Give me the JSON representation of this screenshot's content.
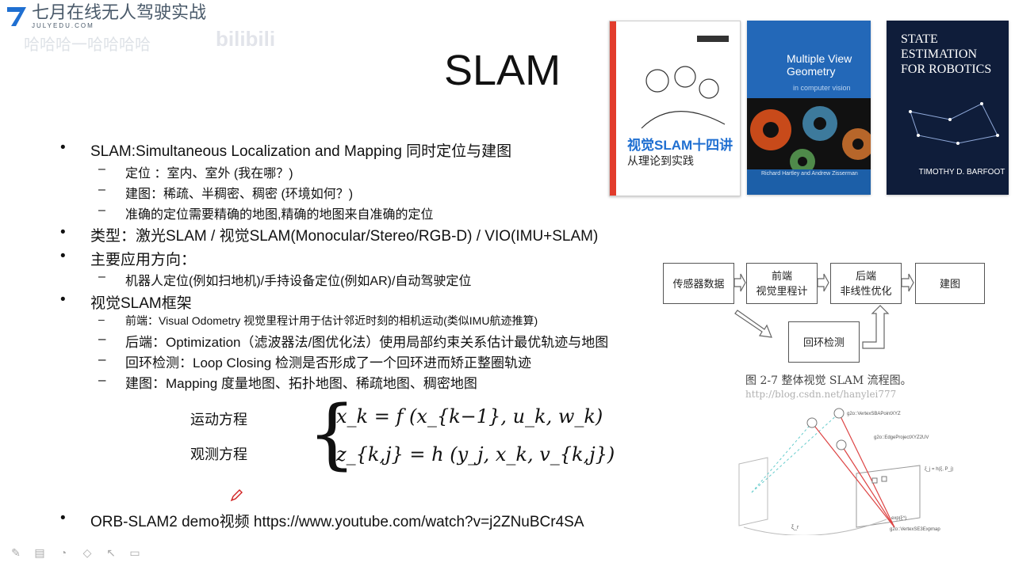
{
  "brand": {
    "name": "七月在线",
    "course": "无人驾驶实战",
    "domain": "JULYEDU.COM"
  },
  "watermark": {
    "text1": "哈哈哈一哈哈哈哈",
    "text2": "bilibili"
  },
  "slide": {
    "title": "SLAM",
    "bullets": {
      "b1": "SLAM:Simultaneous Localization and Mapping  同时定位与建图",
      "b1_subs": [
        "定位 ：室内、室外  (我在哪？)",
        "建图：稀疏、半稠密、稠密 (环境如何？)",
        "准确的定位需要精确的地图,精确的地图来自准确的定位"
      ],
      "b2": "类型：激光SLAM / 视觉SLAM(Monocular/Stereo/RGB-D) / VIO(IMU+SLAM)",
      "b3": "主要应用方向：",
      "b3_subs": [
        "机器人定位(例如扫地机)/手持设备定位(例如AR)/自动驾驶定位"
      ],
      "b4": "视觉SLAM框架",
      "b4_subs": [
        "前端：Visual Odometry  视觉里程计用于估计邻近时刻的相机运动(类似IMU航迹推算)",
        "后端：Optimization（滤波器法/图优化法）使用局部约束关系估计最优轨迹与地图",
        "回环检测：Loop Closing 检测是否形成了一个回环进而矫正整圈轨迹",
        "建图：Mapping  度量地图、拓扑地图、稀疏地图、稠密地图"
      ],
      "b5": "ORB-SLAM2 demo视频 https://www.youtube.com/watch?v=j2ZNuBCr4SA"
    },
    "equations": {
      "motion_label": "运动方程",
      "observe_label": "观测方程",
      "motion_eq": "x_k = f (x_{k−1}, u_k, w_k)",
      "observe_eq": "z_{k,j} = h (y_j, x_k, v_{k,j})"
    },
    "books": {
      "book1_title": "视觉SLAM十四讲",
      "book1_sub": "从理论到实践",
      "book2_title": "Multiple View Geometry",
      "book2_sub": "in computer vision",
      "book2_authors": "Richard Hartley and Andrew Zisserman",
      "book3_title": "STATE ESTIMATION FOR ROBOTICS",
      "book3_author": "TIMOTHY D. BARFOOT"
    },
    "flowchart": {
      "sensor": "传感器数据",
      "frontend": "前端\n视觉里程计",
      "backend": "后端\n非线性优化",
      "mapping": "建图",
      "loop": "回环检测",
      "caption": "图 2-7   整体视觉 SLAM 流程图。",
      "caption_wm": "http://blog.csdn.net/hanylei777"
    },
    "diagram": {
      "label1": "g2o::VertexSBAPointXYZ",
      "label2": "g2o::EdgeProjectXYZ2UV",
      "label3": "g2o::VertexSE3Expmap",
      "label4": "ξ_j = h(ξ, P_j)",
      "label5": "exp(ξ^)",
      "label6": "ξ_r"
    }
  },
  "colors": {
    "brand": "#1f6fd1",
    "accent": "#e25a00"
  }
}
